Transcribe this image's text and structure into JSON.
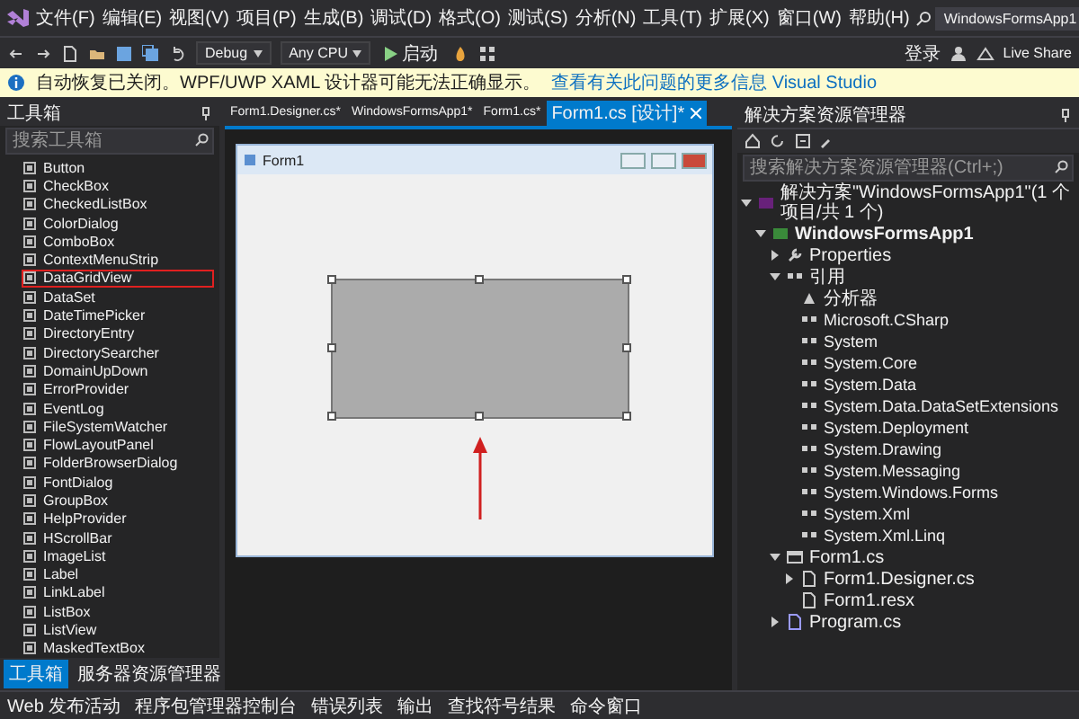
{
  "menu_bar": {
    "items": [
      "文件(F)",
      "编辑(E)",
      "视图(V)",
      "项目(P)",
      "生成(B)",
      "调试(D)",
      "格式(O)",
      "测试(S)",
      "分析(N)",
      "工具(T)",
      "扩展(X)",
      "窗口(W)",
      "帮助(H)"
    ],
    "title": "WindowsFormsApp1"
  },
  "toolbar": {
    "configuration": "Debug",
    "platform": "Any CPU",
    "start": "启动",
    "account": "登录",
    "live_share": "Live Share"
  },
  "info_bar": {
    "message": "自动恢复已关闭。WPF/UWP XAML 设计器可能无法正确显示。",
    "link": "查看有关此问题的更多信息 Visual Studio"
  },
  "toolbox": {
    "title": "工具箱",
    "search": {
      "placeholder": "搜索工具箱"
    },
    "items": [
      {
        "label": "Button",
        "marked": false
      },
      {
        "label": "CheckBox",
        "marked": false
      },
      {
        "label": "CheckedListBox",
        "marked": false
      },
      {
        "label": "ColorDialog",
        "marked": false
      },
      {
        "label": "ComboBox",
        "marked": false
      },
      {
        "label": "ContextMenuStrip",
        "marked": false
      },
      {
        "label": "DataGridView",
        "marked": true
      },
      {
        "label": "DataSet",
        "marked": false
      },
      {
        "label": "DateTimePicker",
        "marked": false
      },
      {
        "label": "DirectoryEntry",
        "marked": false
      },
      {
        "label": "DirectorySearcher",
        "marked": false
      },
      {
        "label": "DomainUpDown",
        "marked": false
      },
      {
        "label": "ErrorProvider",
        "marked": false
      },
      {
        "label": "EventLog",
        "marked": false
      },
      {
        "label": "FileSystemWatcher",
        "marked": false
      },
      {
        "label": "FlowLayoutPanel",
        "marked": false
      },
      {
        "label": "FolderBrowserDialog",
        "marked": false
      },
      {
        "label": "FontDialog",
        "marked": false
      },
      {
        "label": "GroupBox",
        "marked": false
      },
      {
        "label": "HelpProvider",
        "marked": false
      },
      {
        "label": "HScrollBar",
        "marked": false
      },
      {
        "label": "ImageList",
        "marked": false
      },
      {
        "label": "Label",
        "marked": false
      },
      {
        "label": "LinkLabel",
        "marked": false
      },
      {
        "label": "ListBox",
        "marked": false
      },
      {
        "label": "ListView",
        "marked": false
      },
      {
        "label": "MaskedTextBox",
        "marked": false
      }
    ],
    "tabs": [
      {
        "label": "工具箱",
        "selected": true
      },
      {
        "label": "服务器资源管理器",
        "selected": false
      }
    ]
  },
  "editor_tabs": [
    {
      "label": "Form1.Designer.cs*",
      "selected": false
    },
    {
      "label": "WindowsFormsApp1*",
      "selected": false
    },
    {
      "label": "Form1.cs*",
      "selected": false
    },
    {
      "label": "Form1.cs [设计]*",
      "selected": true
    }
  ],
  "designer": {
    "form_title": "Form1"
  },
  "solution_explorer": {
    "title": "解决方案资源管理器",
    "search": {
      "placeholder": "搜索解决方案资源管理器(Ctrl+;)"
    },
    "tree": [
      {
        "label": "解决方案\"WindowsFormsApp1\"(1 个项目/共 1 个)",
        "kind": "solution",
        "expanded": true,
        "children": [
          {
            "label": "WindowsFormsApp1",
            "kind": "project",
            "expanded": true,
            "children": [
              {
                "label": "Properties",
                "kind": "properties",
                "expanded": false
              },
              {
                "label": "引用",
                "kind": "references",
                "expanded": true,
                "children": [
                  {
                    "label": "分析器",
                    "kind": "analyzer"
                  },
                  {
                    "label": "Microsoft.CSharp",
                    "kind": "reference"
                  },
                  {
                    "label": "System",
                    "kind": "reference"
                  },
                  {
                    "label": "System.Core",
                    "kind": "reference"
                  },
                  {
                    "label": "System.Data",
                    "kind": "reference"
                  },
                  {
                    "label": "System.Data.DataSetExtensions",
                    "kind": "reference"
                  },
                  {
                    "label": "System.Deployment",
                    "kind": "reference"
                  },
                  {
                    "label": "System.Drawing",
                    "kind": "reference"
                  },
                  {
                    "label": "System.Messaging",
                    "kind": "reference"
                  },
                  {
                    "label": "System.Windows.Forms",
                    "kind": "reference"
                  },
                  {
                    "label": "System.Xml",
                    "kind": "reference"
                  },
                  {
                    "label": "System.Xml.Linq",
                    "kind": "reference"
                  }
                ]
              },
              {
                "label": "Form1.cs",
                "kind": "form",
                "expanded": true,
                "children": [
                  {
                    "label": "Form1.Designer.cs",
                    "kind": "file",
                    "expanded": false
                  },
                  {
                    "label": "Form1.resx",
                    "kind": "file"
                  }
                ]
              },
              {
                "label": "Program.cs",
                "kind": "code",
                "expanded": false
              }
            ]
          }
        ]
      }
    ]
  },
  "status_bar": {
    "tabs": [
      "Web 发布活动",
      "程序包管理器控制台",
      "错误列表",
      "输出",
      "查找符号结果",
      "命令窗口"
    ]
  }
}
